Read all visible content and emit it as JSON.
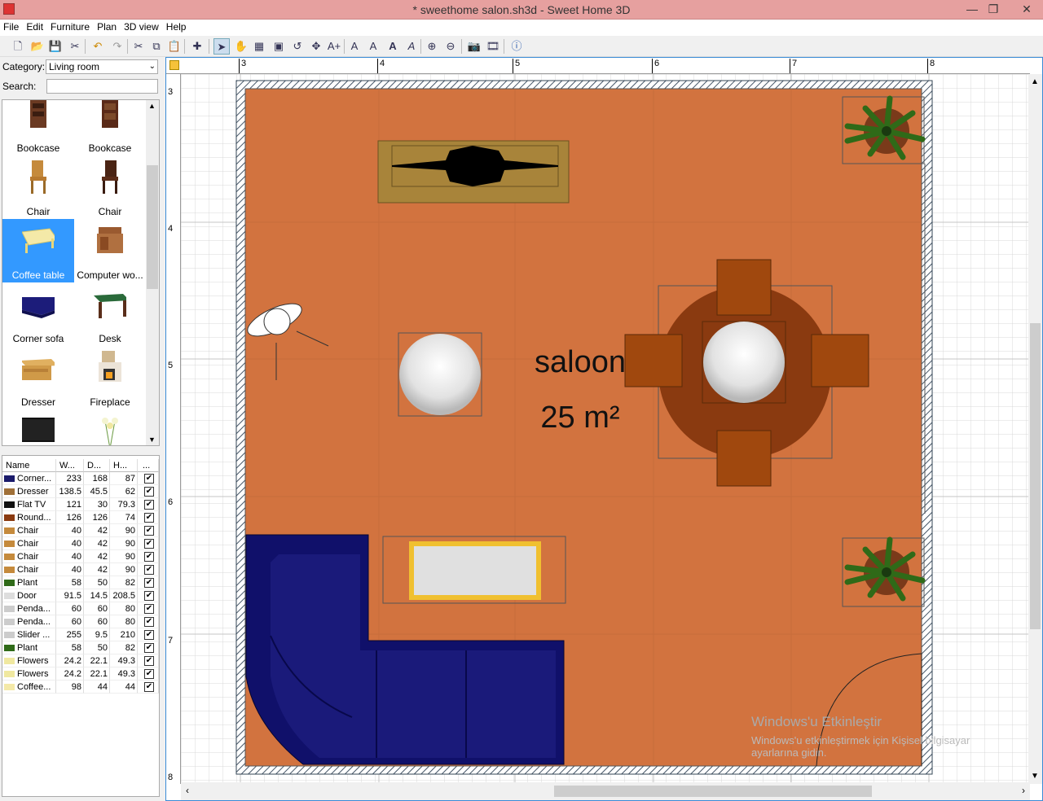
{
  "window": {
    "title": "* sweethome salon.sh3d - Sweet Home 3D"
  },
  "menu": [
    "File",
    "Edit",
    "Furniture",
    "Plan",
    "3D view",
    "Help"
  ],
  "category": {
    "label": "Category:",
    "value": "Living room"
  },
  "search": {
    "label": "Search:",
    "value": ""
  },
  "catalog": [
    {
      "label": "Bookcase",
      "icon": "bookcase-icon"
    },
    {
      "label": "Bookcase",
      "icon": "bookcase-icon"
    },
    {
      "label": "Chair",
      "icon": "chair-icon"
    },
    {
      "label": "Chair",
      "icon": "chair-icon"
    },
    {
      "label": "Coffee table",
      "icon": "coffee-table-icon",
      "selected": true
    },
    {
      "label": "Computer wo...",
      "icon": "computer-workstation-icon"
    },
    {
      "label": "Corner sofa",
      "icon": "corner-sofa-icon"
    },
    {
      "label": "Desk",
      "icon": "desk-icon"
    },
    {
      "label": "Dresser",
      "icon": "dresser-icon"
    },
    {
      "label": "Fireplace",
      "icon": "fireplace-icon"
    },
    {
      "label": "",
      "icon": "flat-tv-icon"
    },
    {
      "label": "",
      "icon": "flowers-icon"
    }
  ],
  "table": {
    "headers": [
      "Name",
      "W...",
      "D...",
      "H...",
      "..."
    ],
    "rows": [
      [
        "Corner...",
        "233",
        "168",
        "87"
      ],
      [
        "Dresser",
        "138.5",
        "45.5",
        "62"
      ],
      [
        "Flat TV",
        "121",
        "30",
        "79.3"
      ],
      [
        "Round...",
        "126",
        "126",
        "74"
      ],
      [
        "Chair",
        "40",
        "42",
        "90"
      ],
      [
        "Chair",
        "40",
        "42",
        "90"
      ],
      [
        "Chair",
        "40",
        "42",
        "90"
      ],
      [
        "Chair",
        "40",
        "42",
        "90"
      ],
      [
        "Plant",
        "58",
        "50",
        "82"
      ],
      [
        "Door",
        "91.5",
        "14.5",
        "208.5"
      ],
      [
        "Penda...",
        "60",
        "60",
        "80"
      ],
      [
        "Penda...",
        "60",
        "60",
        "80"
      ],
      [
        "Slider ...",
        "255",
        "9.5",
        "210"
      ],
      [
        "Plant",
        "58",
        "50",
        "82"
      ],
      [
        "Flowers",
        "24.2",
        "22.1",
        "49.3"
      ],
      [
        "Flowers",
        "24.2",
        "22.1",
        "49.3"
      ],
      [
        "Coffee...",
        "98",
        "44",
        "44"
      ]
    ]
  },
  "plan": {
    "room_name": "saloon",
    "room_area": "25 m²",
    "ruler_x": [
      "3",
      "4",
      "5",
      "6",
      "7",
      "8"
    ],
    "ruler_y": [
      "3",
      "4",
      "5",
      "6",
      "7",
      "8"
    ],
    "floor_color": "#d2733f"
  },
  "watermark": {
    "line1": "Windows'u Etkinleştir",
    "line2": "Windows'u etkinleştirmek için Kişisel bilgisayar",
    "line3": "ayarlarına gidin."
  }
}
